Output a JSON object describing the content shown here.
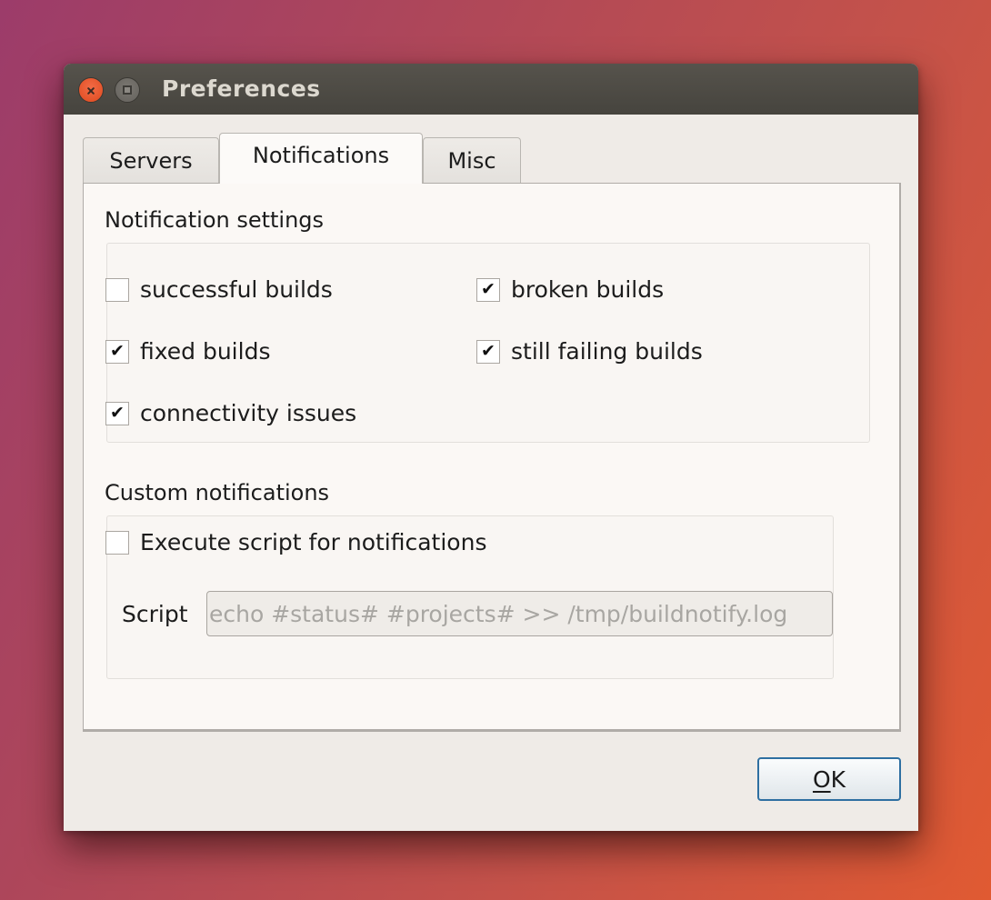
{
  "window": {
    "title": "Preferences",
    "controls": [
      {
        "name": "close",
        "icon": "close-icon"
      },
      {
        "name": "maximize",
        "icon": "maximize-icon"
      }
    ]
  },
  "tabs": [
    {
      "label": "Servers",
      "active": false
    },
    {
      "label": "Notifications",
      "active": true
    },
    {
      "label": "Misc",
      "active": false
    }
  ],
  "notification_settings": {
    "title": "Notification settings",
    "options": [
      {
        "label": "successful builds",
        "checked": false
      },
      {
        "label": "broken builds",
        "checked": true
      },
      {
        "label": "fixed builds",
        "checked": true
      },
      {
        "label": "still failing builds",
        "checked": true
      },
      {
        "label": "connectivity issues",
        "checked": true
      }
    ]
  },
  "custom_notifications": {
    "title": "Custom notifications",
    "execute_script": {
      "label": "Execute script for notifications",
      "checked": false
    },
    "script": {
      "label": "Script",
      "value": "echo #status# #projects# >> /tmp/buildnotify.log",
      "enabled": false
    }
  },
  "buttons": {
    "ok": {
      "mnemonic": "O",
      "rest": "K"
    }
  },
  "check_glyph": "✔"
}
